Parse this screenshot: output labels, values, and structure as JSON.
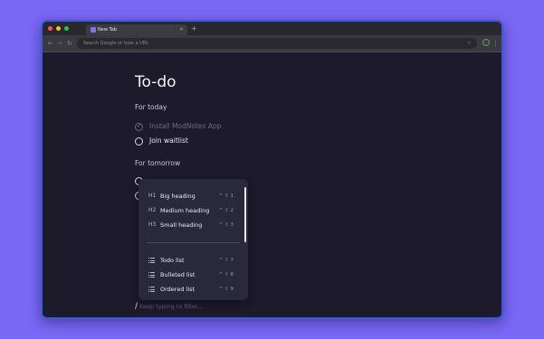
{
  "browser": {
    "tab_title": "New Tab",
    "tab_close": "×",
    "new_tab": "+",
    "address_placeholder": "Search Google or type a URL"
  },
  "page": {
    "title": "To-do",
    "today": {
      "heading": "For today",
      "items": [
        {
          "label": "Install ModNotes App",
          "done": true
        },
        {
          "label": "Join waitlist",
          "done": false
        }
      ]
    },
    "tomorrow": {
      "heading": "For tomorrow"
    }
  },
  "menu": {
    "items": [
      {
        "icon": "H1",
        "label": "Big heading",
        "shortcut": "^ ⇧ 1"
      },
      {
        "icon": "H2",
        "label": "Medium heading",
        "shortcut": "^ ⇧ 2"
      },
      {
        "icon": "H3",
        "label": "Small heading",
        "shortcut": "^ ⇧ 3"
      },
      {
        "icon": "list-icon",
        "label": "Todo list",
        "shortcut": "^ ⇧ 7"
      },
      {
        "icon": "list-icon",
        "label": "Bulleted list",
        "shortcut": "^ ⇧ 8"
      },
      {
        "icon": "list-icon",
        "label": "Ordered list",
        "shortcut": "^ ⇧ 9"
      }
    ]
  },
  "filter": {
    "prefix": "/",
    "placeholder": "Keep typing to filter..."
  },
  "colors": {
    "background": "#7868f4",
    "page": "#1c1a2b",
    "menu": "#2a2939",
    "window_border": "#3b5bd8"
  }
}
